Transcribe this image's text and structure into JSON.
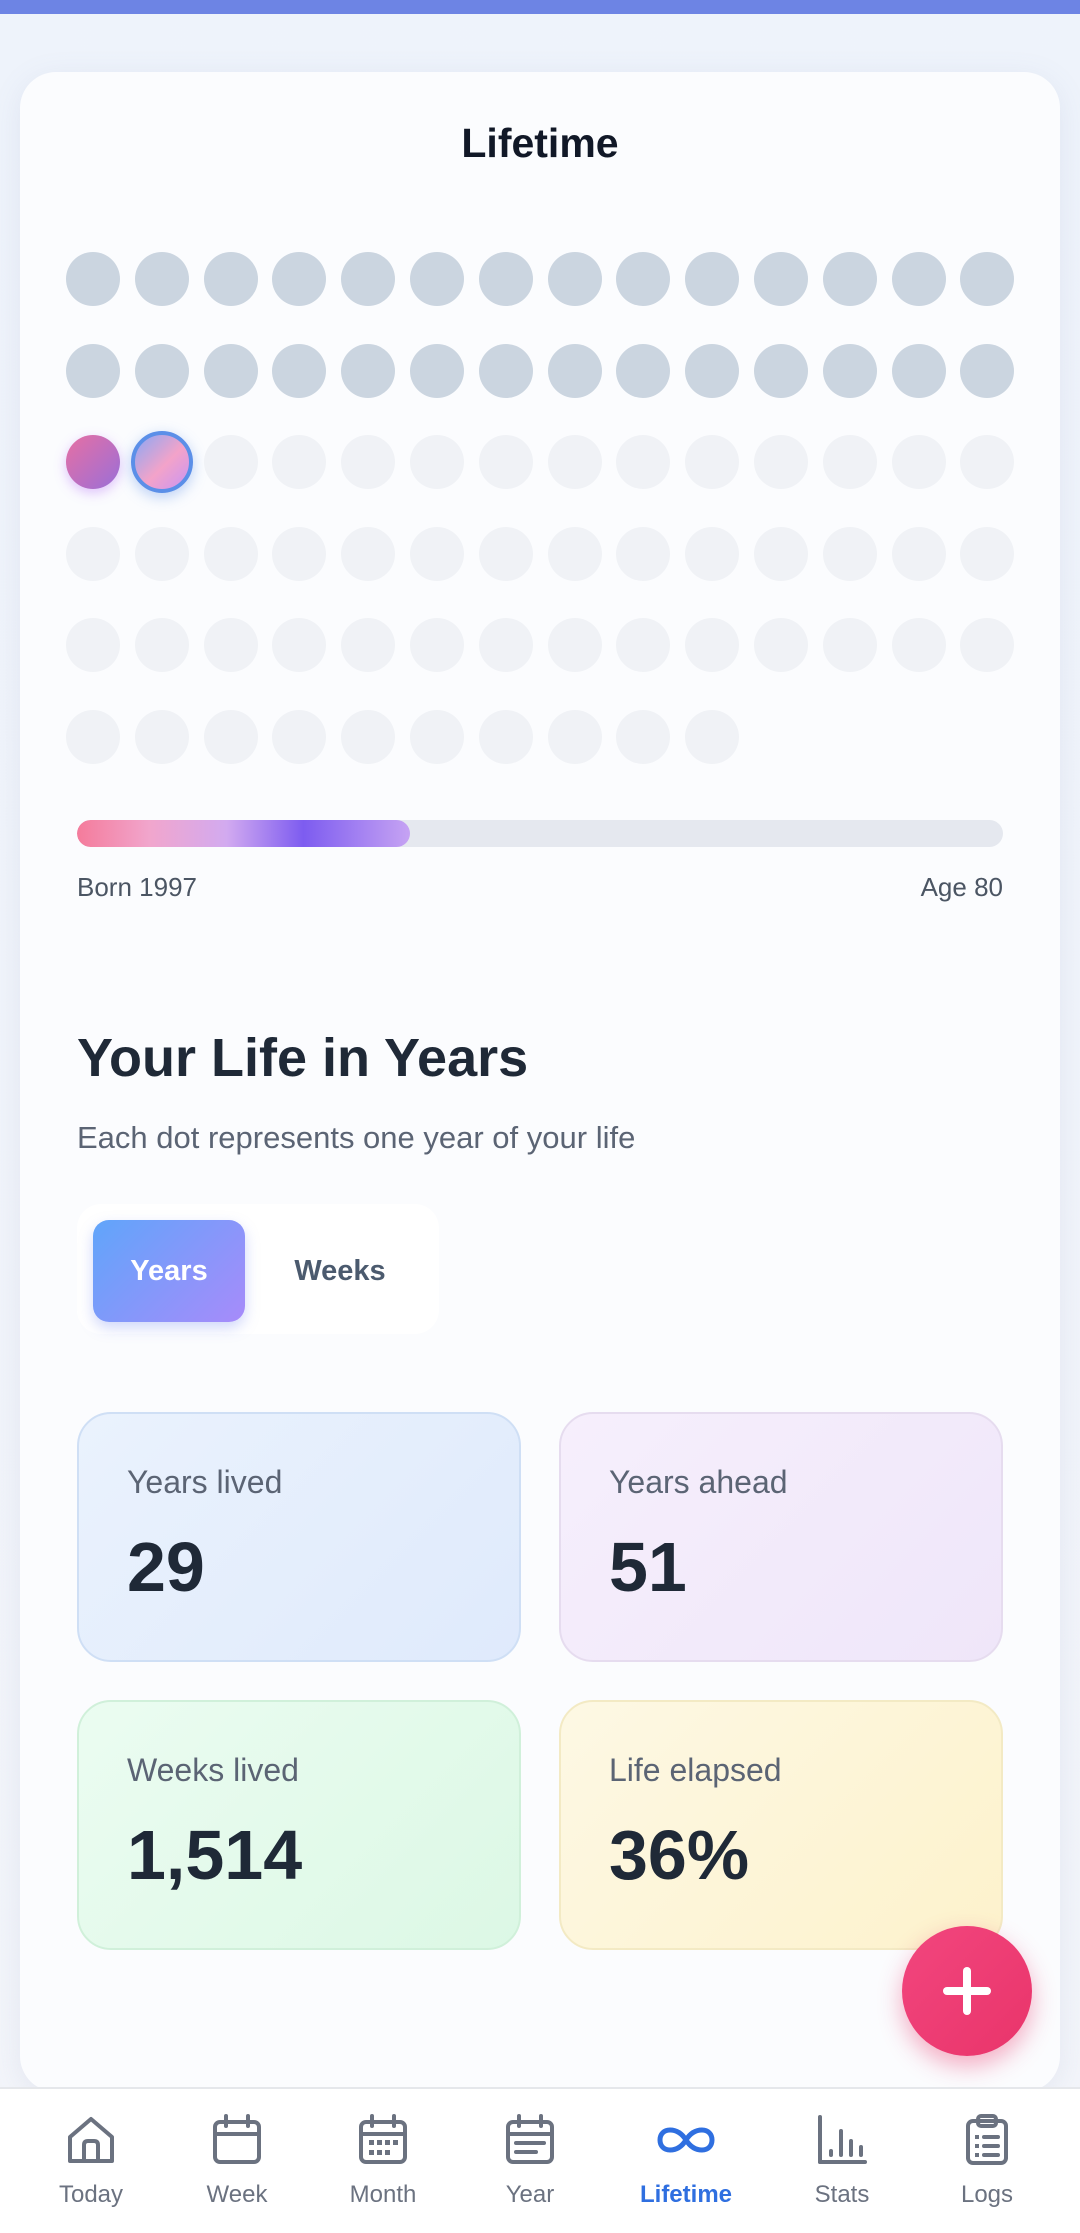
{
  "lifetime": {
    "title": "Lifetime",
    "total_years": 80,
    "years_lived": 29,
    "current_year_index": 29,
    "born_label": "Born 1997",
    "age_label": "Age 80",
    "progress_fraction": 0.36
  },
  "section": {
    "title": "Your Life in Years",
    "subtitle": "Each dot represents one year of your life"
  },
  "toggle": {
    "years_label": "Years",
    "weeks_label": "Weeks",
    "selected": "Years"
  },
  "stats": [
    {
      "label": "Years lived",
      "value": "29"
    },
    {
      "label": "Years ahead",
      "value": "51"
    },
    {
      "label": "Weeks lived",
      "value": "1,514"
    },
    {
      "label": "Life elapsed",
      "value": "36%"
    }
  ],
  "colors": {
    "accent": "#2f6fe0",
    "fab": "#e9346a",
    "past_dot": "#cbd5e0",
    "future_dot": "#f0f2f6"
  },
  "nav": {
    "items": [
      {
        "label": "Today",
        "icon": "home-icon"
      },
      {
        "label": "Week",
        "icon": "calendar-icon"
      },
      {
        "label": "Month",
        "icon": "calendar-grid-icon"
      },
      {
        "label": "Year",
        "icon": "calendar-list-icon"
      },
      {
        "label": "Lifetime",
        "icon": "infinity-icon",
        "active": true
      },
      {
        "label": "Stats",
        "icon": "bar-chart-icon"
      },
      {
        "label": "Logs",
        "icon": "clipboard-icon"
      }
    ]
  }
}
